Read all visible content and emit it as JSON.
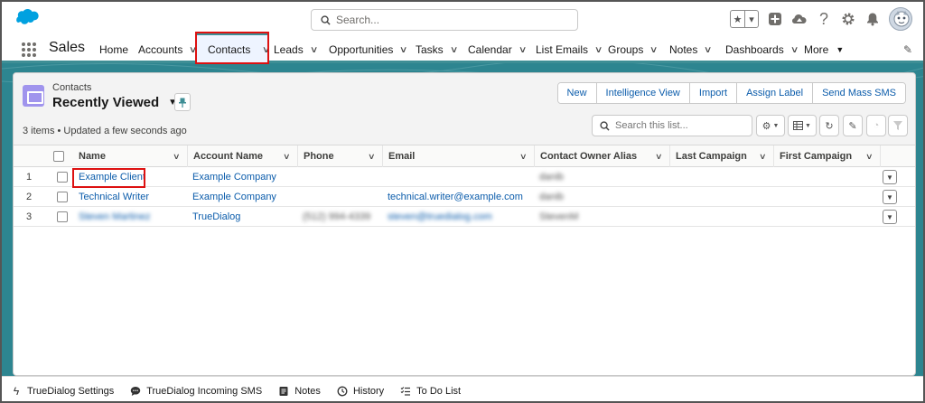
{
  "global_header": {
    "search_placeholder": "Search...",
    "icons": [
      "favorites-star-icon",
      "favorites-dropdown-icon",
      "add-icon",
      "trailhead-icon",
      "help-icon",
      "setup-gear-icon",
      "notifications-bell-icon",
      "user-avatar"
    ]
  },
  "nav": {
    "app_name": "Sales",
    "items": [
      {
        "label": "Home",
        "has_menu": false
      },
      {
        "label": "Accounts",
        "has_menu": true
      },
      {
        "label": "Contacts",
        "has_menu": true,
        "active": true
      },
      {
        "label": "Leads",
        "has_menu": true
      },
      {
        "label": "Opportunities",
        "has_menu": true
      },
      {
        "label": "Tasks",
        "has_menu": true
      },
      {
        "label": "Calendar",
        "has_menu": true
      },
      {
        "label": "List Emails",
        "has_menu": true
      },
      {
        "label": "Groups",
        "has_menu": true
      },
      {
        "label": "Notes",
        "has_menu": true
      },
      {
        "label": "Dashboards",
        "has_menu": true
      },
      {
        "label": "More",
        "has_menu": true
      }
    ],
    "accent_color": "#3e8e95"
  },
  "list_view": {
    "object_label": "Contacts",
    "title": "Recently Viewed",
    "meta": "3 items • Updated a few seconds ago",
    "actions": [
      "New",
      "Intelligence View",
      "Import",
      "Assign Label",
      "Send Mass SMS"
    ],
    "search_placeholder": "Search this list...",
    "columns": [
      "Name",
      "Account Name",
      "Phone",
      "Email",
      "Contact Owner Alias",
      "Last Campaign",
      "First Campaign"
    ],
    "rows": [
      {
        "num": "1",
        "name": "Example Client",
        "account": "Example Company",
        "phone": "",
        "email": "",
        "owner": "danib",
        "last_campaign": "",
        "first_campaign": "",
        "name_blurred": false
      },
      {
        "num": "2",
        "name": "Technical Writer",
        "account": "Example Company",
        "phone": "",
        "email": "technical.writer@example.com",
        "owner": "danib",
        "last_campaign": "",
        "first_campaign": "",
        "name_blurred": false
      },
      {
        "num": "3",
        "name": "Steven Martinez",
        "account": "TrueDialog",
        "phone": "(512) 994-4339",
        "email": "steven@truedialog.com",
        "owner": "StevenM",
        "last_campaign": "",
        "first_campaign": "",
        "name_blurred": true
      }
    ]
  },
  "utility_bar": {
    "items": [
      {
        "label": "TrueDialog Settings",
        "icon": "bolt-icon"
      },
      {
        "label": "TrueDialog Incoming SMS",
        "icon": "chat-icon"
      },
      {
        "label": "Notes",
        "icon": "notes-icon"
      },
      {
        "label": "History",
        "icon": "history-clock-icon"
      },
      {
        "label": "To Do List",
        "icon": "todo-list-icon"
      }
    ]
  },
  "colors": {
    "brand_blue": "#00a1e0",
    "link": "#0b5cab",
    "teal_band": "#2d8590",
    "highlight_red": "#dd1111"
  }
}
